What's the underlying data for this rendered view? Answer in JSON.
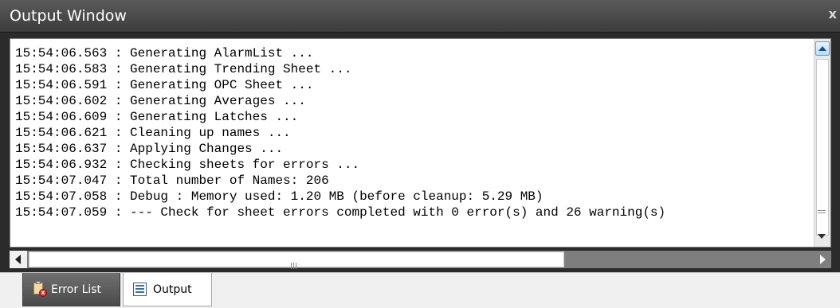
{
  "window": {
    "title": "Output Window",
    "close_glyph": "x"
  },
  "log": [
    "15:54:06.563 : Generating AlarmList ...",
    "15:54:06.583 : Generating Trending Sheet ...",
    "15:54:06.591 : Generating OPC Sheet ...",
    "15:54:06.602 : Generating Averages ...",
    "15:54:06.609 : Generating Latches ...",
    "15:54:06.621 : Cleaning up names ...",
    "15:54:06.637 : Applying Changes ...",
    "15:54:06.932 : Checking sheets for errors ...",
    "15:54:07.047 : Total number of Names: 206",
    "15:54:07.058 : Debug : Memory used: 1.20 MB (before cleanup: 5.29 MB)",
    "15:54:07.059 : --- Check for sheet errors completed with 0 error(s) and 26 warning(s)"
  ],
  "tabs": [
    {
      "id": "error-list",
      "label": "Error List",
      "icon": "error-list-icon",
      "active": false
    },
    {
      "id": "output",
      "label": "Output",
      "icon": "output-icon",
      "active": true
    }
  ],
  "colors": {
    "titlebar": "#4a4a4a",
    "frame": "#2b2b2b",
    "log_background": "#ffffff",
    "inactive_tab": "#5a5a5a",
    "active_tab": "#ffffff"
  }
}
